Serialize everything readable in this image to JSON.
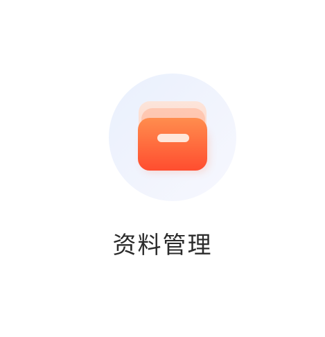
{
  "tile": {
    "label": "资料管理",
    "icon": "folder-archive-icon",
    "colors": {
      "circle_bg": "#eef2fd",
      "folder_front_top": "#ff8a4c",
      "folder_front_bottom": "#ff4f2e",
      "folder_back": "#ffd9c8",
      "handle": "#ffe4d8",
      "label_text": "#2b2b2b"
    }
  }
}
